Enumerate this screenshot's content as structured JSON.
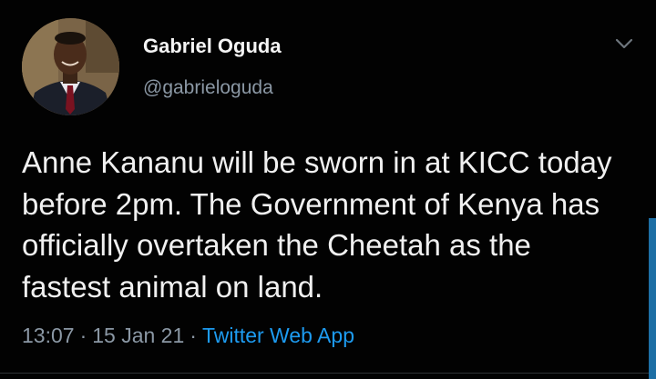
{
  "tweet": {
    "author": {
      "display_name": "Gabriel Oguda",
      "handle": "@gabrieloguda",
      "avatar_icon": "profile-photo"
    },
    "menu_icon": "chevron-down-icon",
    "text": "Anne Kananu will be sworn in at KICC today before 2pm. The Government of Kenya has officially overtaken the Cheetah as the fastest animal on land.",
    "time": "13:07",
    "separator": "·",
    "date": "15 Jan 21",
    "source": "Twitter Web App"
  },
  "colors": {
    "background": "#000000",
    "text": "#f0f0f0",
    "secondary": "#8b98a5",
    "link": "#1d9bf0",
    "scrollbar": "#1d6fa5"
  }
}
